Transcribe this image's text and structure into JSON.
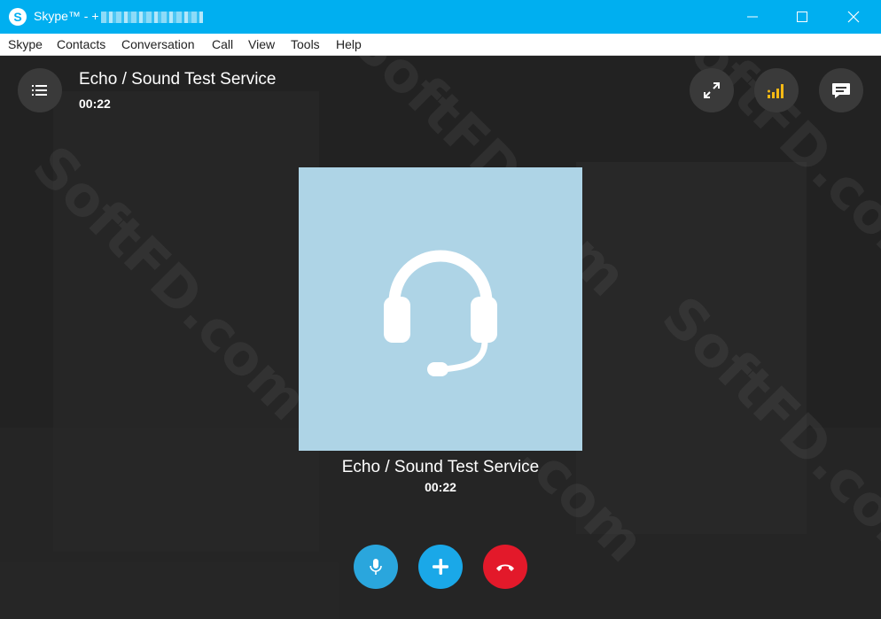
{
  "window": {
    "title": "Skype™ - +",
    "app_icon_letter": "S"
  },
  "menu": {
    "items": [
      "Skype",
      "Contacts",
      "Conversation",
      "Call",
      "View",
      "Tools",
      "Help"
    ]
  },
  "call": {
    "contact_name": "Echo / Sound Test Service",
    "duration": "00:22"
  },
  "watermark": "SoftFD.com",
  "icons": {
    "menu_toggle": "list-icon",
    "fullscreen": "expand-icon",
    "signal": "signal-bars-icon",
    "chat": "chat-bubble-icon",
    "avatar": "headset-icon",
    "mic": "microphone-icon",
    "add": "plus-icon",
    "hangup": "hang-up-icon"
  },
  "colors": {
    "titlebar": "#00aff0",
    "stage_bg": "#222222",
    "avatar_bg": "#aed4e6",
    "mic_button": "#2aa6dd",
    "add_button": "#1aa8e8",
    "end_button": "#e3192a",
    "signal": "#f5b914"
  }
}
